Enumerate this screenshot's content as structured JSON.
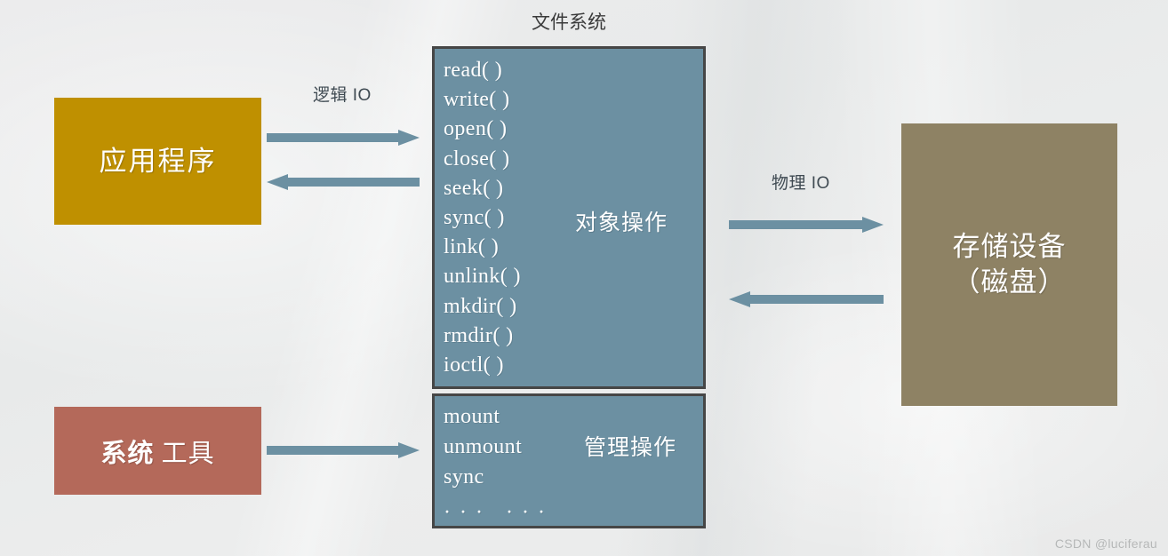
{
  "diagram": {
    "title": "文件系统",
    "background_color": "#ebecec",
    "accent_color": "#6c90a2"
  },
  "blocks": {
    "application": {
      "label": "应用程序",
      "color": "#bf9000"
    },
    "system_tools": {
      "label_strong": "系统",
      "label_light": " 工具",
      "color": "#b4695a"
    },
    "storage_device": {
      "line1": "存储设备",
      "line2": "（磁盘）",
      "color": "#8e8264"
    }
  },
  "filesystem": {
    "object_section": {
      "section_label": "对象操作",
      "functions": "read( )\nwrite( )\nopen( )\nclose( )\nseek( )\nsync( )\nlink( )\nunlink( )\nmkdir( )\nrmdir( )\nioctl( )"
    },
    "management_section": {
      "section_label": "管理操作",
      "functions": "mount\nunmount\nsync",
      "ellipsis": "· · ·   · · ·"
    }
  },
  "arrows": {
    "logical_io_label": "逻辑 IO",
    "physical_io_label": "物理 IO",
    "color": "#6c90a2"
  },
  "watermark": "CSDN @luciferau"
}
